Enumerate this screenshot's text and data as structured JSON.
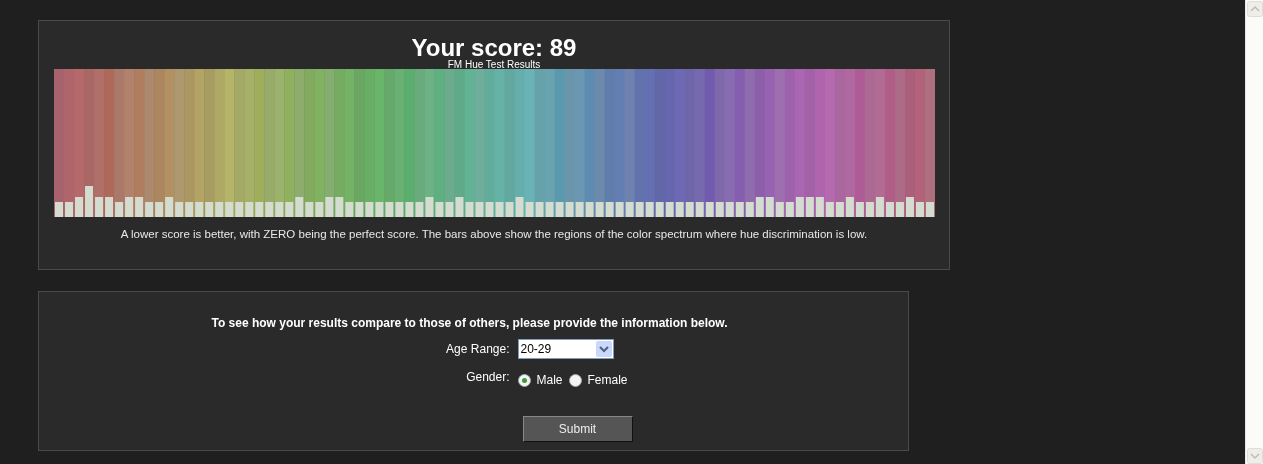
{
  "results": {
    "title": "Your score: 89",
    "subtitle": "FM Hue Test Results",
    "note": "A lower score is better, with ZERO being the perfect score. The bars above show the regions of the color spectrum where hue discrimination is low."
  },
  "form": {
    "intro": "To see how your results compare to those of others, please provide the information below.",
    "age": {
      "label": "Age Range:",
      "value": "20-29"
    },
    "gender": {
      "label": "Gender:",
      "options": [
        {
          "label": "Male",
          "selected": true
        },
        {
          "label": "Female",
          "selected": false
        }
      ]
    },
    "submit": "Submit"
  }
}
